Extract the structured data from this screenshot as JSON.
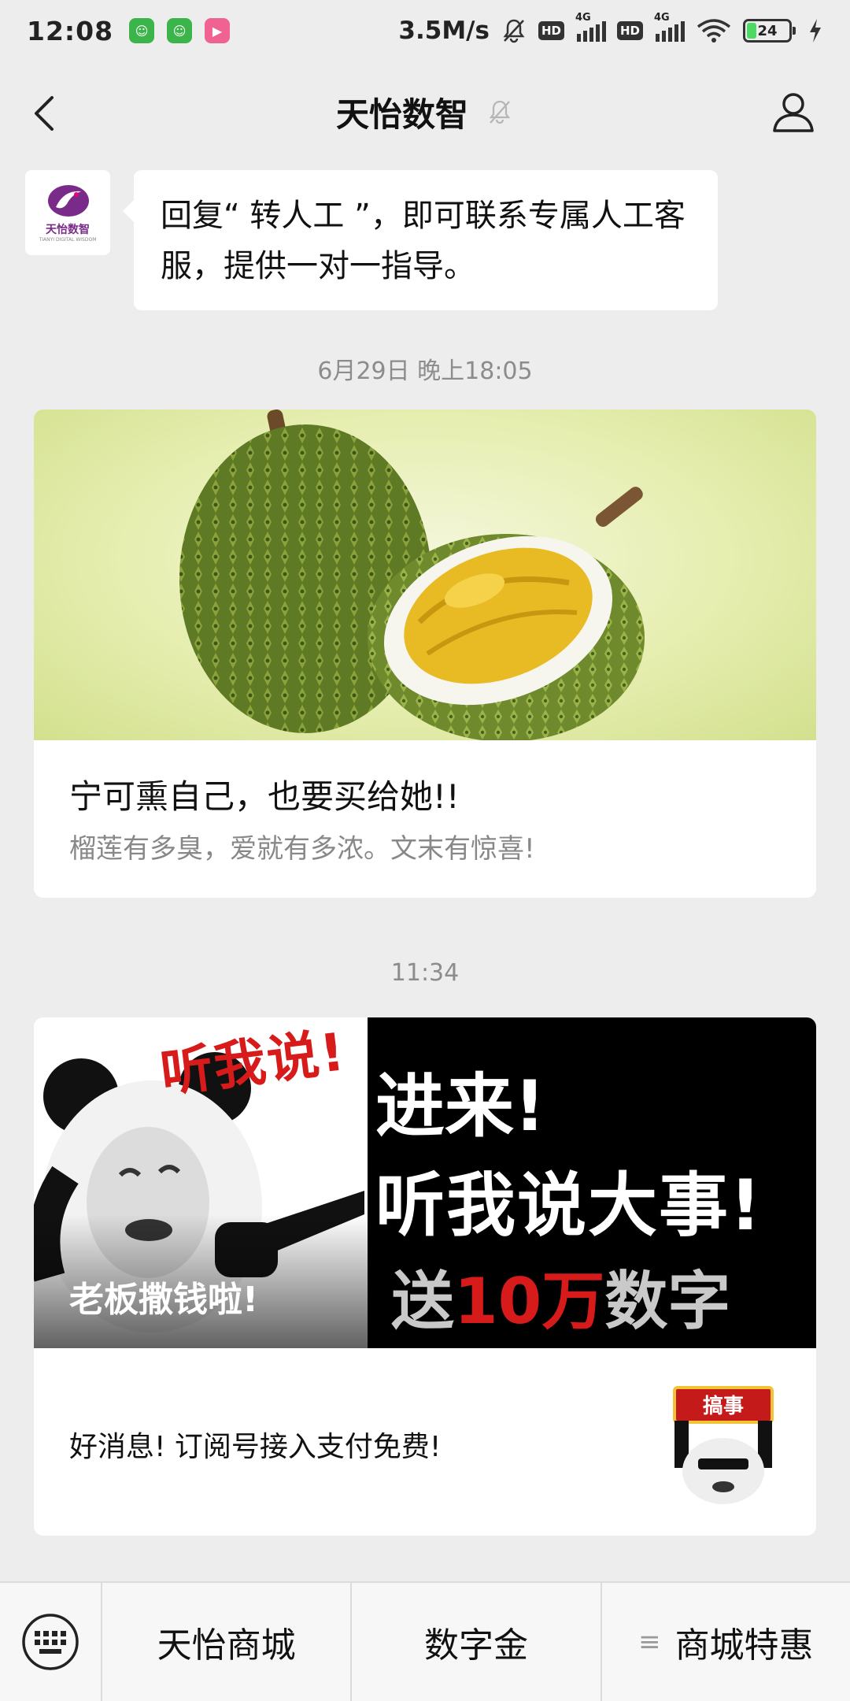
{
  "status_bar": {
    "time": "12:08",
    "speed": "3.5M/s",
    "hd1": "HD",
    "hd2": "HD",
    "net1": "4G",
    "net2": "4G",
    "battery": "24"
  },
  "nav": {
    "title": "天怡数智"
  },
  "account_logo": {
    "name": "天怡数智",
    "sub": "TIANYI DIGITAL WISDOM"
  },
  "greeting": {
    "text": "回复“ 转人工 ”，即可联系专属人工客服，提供一对一指导。"
  },
  "messages": [
    {
      "timestamp": "6月29日 晚上18:05",
      "title": "宁可熏自己，也要买给她!!",
      "desc": "榴莲有多臭，爱就有多浓。文末有惊喜!"
    },
    {
      "timestamp": "11:34",
      "cover_shout": "听我说!",
      "cover_caption": "老板撒钱啦!",
      "cover_line1": "进来!",
      "cover_line2": "听我说大事!",
      "cover_line3_a": "送",
      "cover_line3_b": "10万",
      "cover_line3_c": "数字金!",
      "sub_title": "好消息! 订阅号接入支付免费!",
      "thumb_banner": "搞事"
    }
  ],
  "menu": {
    "items": [
      "天怡商城",
      "数字金",
      "商城特惠"
    ]
  },
  "colors": {
    "background": "#ededed",
    "accent_red": "#d71a1a",
    "brand_purple": "#7a2b8a"
  }
}
